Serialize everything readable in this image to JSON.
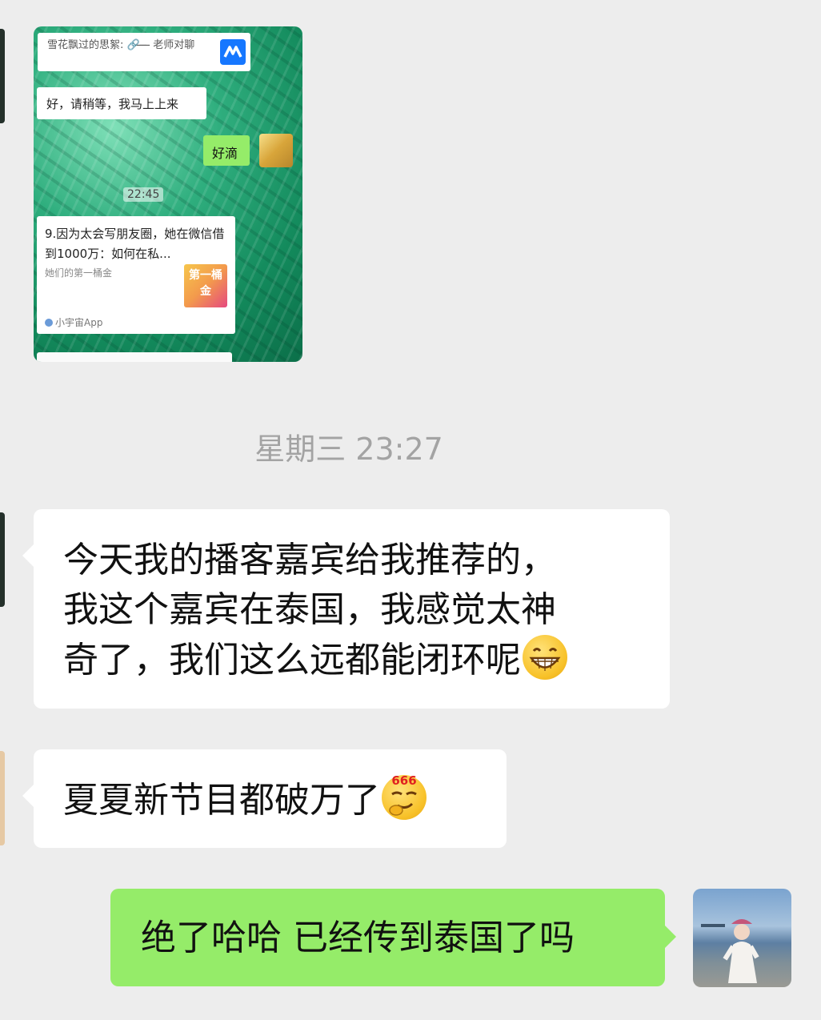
{
  "image_message": {
    "quote_text": "雪花飘过的思絮: 🔗 ̶ ̶ ̶ 老师对聊",
    "reply_text": "好，请稍等，我马上上来",
    "sent_text": "好滴",
    "time": "22:45",
    "card": {
      "title": "9.因为太会写朋友圈，她在微信借到1000万：如何在私...",
      "subtitle": "她们的第一桶金",
      "thumb_text": "第一桶金",
      "source": "小宇宙App"
    }
  },
  "timestamp": "星期三 23:27",
  "messages": [
    {
      "text_line1": "今天我的播客嘉宾给我推荐的，",
      "text_line2": "我这个嘉宾在泰国，我感觉太神",
      "text_line3": "奇了，我们这么远都能闭环呢",
      "emoji": "grin-emoji"
    },
    {
      "text": "夏夏新节目都破万了",
      "emoji": "666-emoji"
    },
    {
      "text": "绝了哈哈 已经传到泰国了吗"
    }
  ],
  "colors": {
    "background": "#ededed",
    "sent_bubble": "#95ec69",
    "received_bubble": "#ffffff"
  }
}
